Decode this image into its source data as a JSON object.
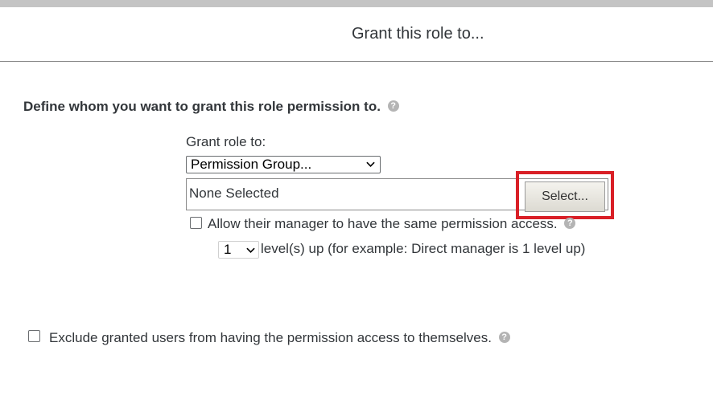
{
  "dialog": {
    "title": "Grant this role to..."
  },
  "section": {
    "heading": "Define whom you want to grant this role permission to.",
    "help_icon": "question-circle-icon"
  },
  "grant": {
    "label": "Grant role to:",
    "selected": "Permission Group...",
    "selection_value": "None Selected",
    "select_button_label": "Select..."
  },
  "manager": {
    "checked": false,
    "label": "Allow their manager to have the same permission access.",
    "level_value": "1",
    "level_text": "level(s) up (for example: Direct manager is 1 level up)"
  },
  "exclude": {
    "checked": false,
    "label": "Exclude granted users from having the permission access to themselves."
  },
  "colors": {
    "highlight": "#d91f26",
    "help_icon": "#b4b4b4",
    "text": "#32363a"
  }
}
